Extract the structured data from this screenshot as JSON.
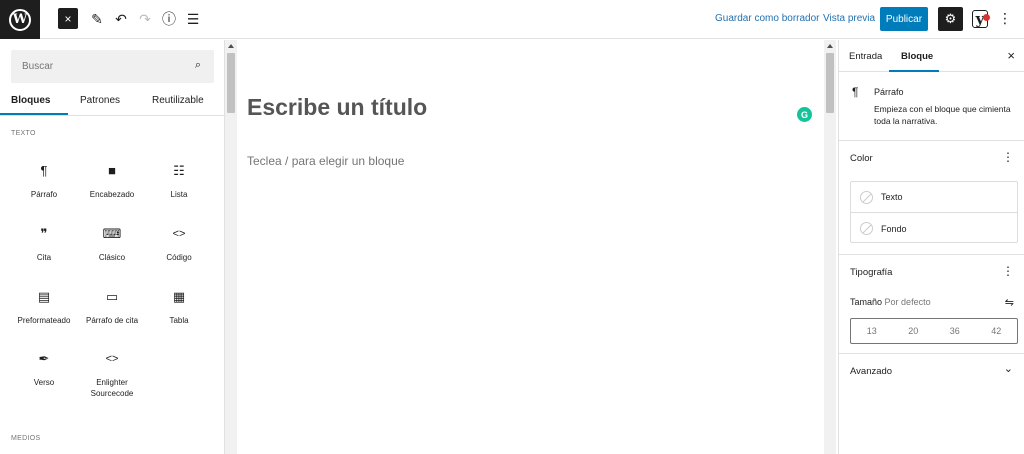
{
  "topbar": {
    "logo_letter": "W",
    "close_icon": "×",
    "pencil_icon": "✎",
    "undo_icon": "↶",
    "redo_icon": "↷",
    "info_icon": "ⓘ",
    "list_icon": "☰",
    "save_draft": "Guardar como borrador",
    "preview": "Vista previa",
    "publish": "Publicar",
    "settings_icon": "⚙",
    "yoast_letter": "y",
    "more_icon": "⋮"
  },
  "inserter": {
    "search_placeholder": "Buscar",
    "search_icon": "⌕",
    "tabs": [
      "Bloques",
      "Patrones",
      "Reutilizable"
    ],
    "section_text": "TEXTO",
    "section_media": "MEDIOS",
    "blocks": [
      {
        "icon": "¶",
        "label": "Párrafo"
      },
      {
        "icon": "🔖",
        "label": "Encabezado"
      },
      {
        "icon": "☷",
        "label": "Lista"
      },
      {
        "icon": "❞",
        "label": "Cita"
      },
      {
        "icon": "⌨",
        "label": "Clásico"
      },
      {
        "icon": "<>",
        "label": "Código"
      },
      {
        "icon": "▤",
        "label": "Preformateado"
      },
      {
        "icon": "▭",
        "label": "Párrafo de cita"
      },
      {
        "icon": "▦",
        "label": "Tabla"
      },
      {
        "icon": "✒",
        "label": "Verso"
      },
      {
        "icon": "<>",
        "label": "Enlighter Sourcecode"
      }
    ]
  },
  "editor": {
    "title_placeholder": "Escribe un título",
    "body_placeholder": "Teclea / para elegir un bloque",
    "grammarly_letter": "G"
  },
  "sidebar": {
    "tabs": [
      "Entrada",
      "Bloque"
    ],
    "close_icon": "×",
    "block_card": {
      "icon": "¶",
      "title": "Párrafo",
      "description": "Empieza con el bloque que cimienta toda la narrativa."
    },
    "color": {
      "heading": "Color",
      "more_icon": "⋮",
      "options": [
        "Texto",
        "Fondo"
      ]
    },
    "typography": {
      "heading": "Tipografía",
      "more_icon": "⋮",
      "size_label": "Tamaño",
      "size_value": "Por defecto",
      "settings_icon": "⇋",
      "sizes": [
        "13",
        "20",
        "36",
        "42"
      ]
    },
    "advanced": {
      "heading": "Avanzado",
      "chevron_icon": "⌄"
    }
  }
}
